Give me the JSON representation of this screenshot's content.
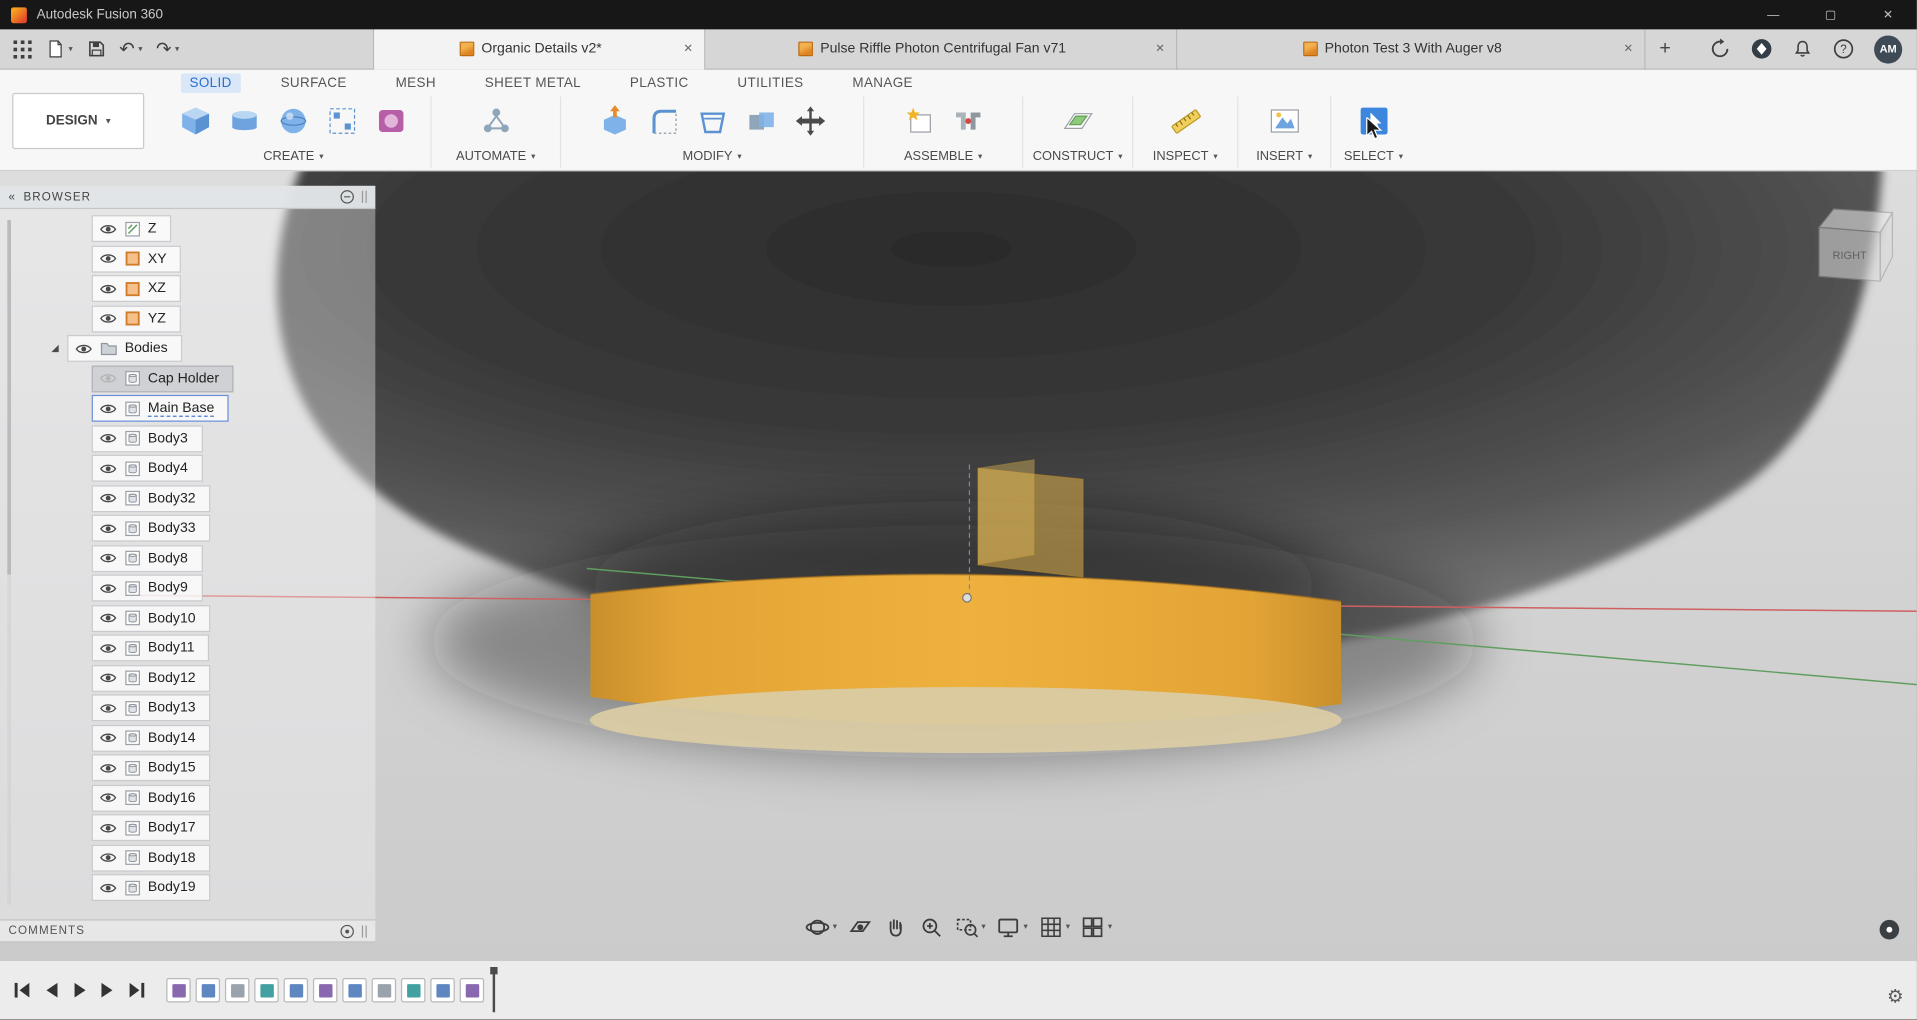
{
  "titlebar": {
    "title": "Autodesk Fusion 360"
  },
  "window_controls": {
    "minimize": "—",
    "maximize": "▢",
    "close": "✕"
  },
  "ui_glyphs": {
    "caret": "▾",
    "chevrons": "«",
    "plus": "+",
    "question": "?",
    "undo": "↶",
    "redo": "↷",
    "gear": "⚙",
    "close": "✕"
  },
  "quick_access": {
    "icons": [
      "app-grid",
      "file",
      "save",
      "undo",
      "redo"
    ]
  },
  "document_tabs": {
    "tabs": [
      {
        "label": "Organic Details v2*",
        "active": true
      },
      {
        "label": "Pulse Riffle Photon Centrifugal Fan v71",
        "active": false
      },
      {
        "label": "Photon Test 3 With Auger v8",
        "active": false
      }
    ],
    "header_icons": [
      "job-status",
      "extensions",
      "notifications",
      "help"
    ],
    "avatar_initials": "AM"
  },
  "ribbon": {
    "workspace": "DESIGN",
    "tabs": [
      {
        "label": "SOLID",
        "active": true
      },
      {
        "label": "SURFACE",
        "active": false
      },
      {
        "label": "MESH",
        "active": false
      },
      {
        "label": "SHEET METAL",
        "active": false
      },
      {
        "label": "PLASTIC",
        "active": false
      },
      {
        "label": "UTILITIES",
        "active": false
      },
      {
        "label": "MANAGE",
        "active": false
      }
    ],
    "groups": [
      {
        "label": "CREATE",
        "icons": [
          "box-primitive",
          "cylinder-primitive",
          "sphere-primitive",
          "pattern",
          "create-form"
        ]
      },
      {
        "label": "AUTOMATE",
        "icons": [
          "automate"
        ]
      },
      {
        "label": "MODIFY",
        "icons": [
          "press-pull",
          "fillet",
          "shell",
          "combine",
          "move-copy"
        ]
      },
      {
        "label": "ASSEMBLE",
        "icons": [
          "new-component",
          "joint"
        ]
      },
      {
        "label": "CONSTRUCT",
        "icons": [
          "construct-plane"
        ]
      },
      {
        "label": "INSPECT",
        "icons": [
          "measure"
        ]
      },
      {
        "label": "INSERT",
        "icons": [
          "canvas"
        ]
      },
      {
        "label": "SELECT",
        "icons": [
          "select-cursor"
        ]
      }
    ]
  },
  "browser": {
    "title": "BROWSER",
    "items": [
      {
        "label": "Z",
        "icon": "sketch",
        "indent": 1,
        "visible": true
      },
      {
        "label": "XY",
        "icon": "plane",
        "indent": 1,
        "visible": true
      },
      {
        "label": "XZ",
        "icon": "plane",
        "indent": 1,
        "visible": true
      },
      {
        "label": "YZ",
        "icon": "plane",
        "indent": 1,
        "visible": true
      },
      {
        "label": "Bodies",
        "icon": "folder",
        "indent": 0,
        "visible": true,
        "expanded": true
      },
      {
        "label": "Cap Holder",
        "icon": "body",
        "indent": 1,
        "visible": false,
        "hovered": true
      },
      {
        "label": "Main Base",
        "icon": "body",
        "indent": 1,
        "visible": true,
        "selected": true
      },
      {
        "label": "Body3",
        "icon": "body",
        "indent": 1,
        "visible": true
      },
      {
        "label": "Body4",
        "icon": "body",
        "indent": 1,
        "visible": true
      },
      {
        "label": "Body32",
        "icon": "body",
        "indent": 1,
        "visible": true
      },
      {
        "label": "Body33",
        "icon": "body",
        "indent": 1,
        "visible": true
      },
      {
        "label": "Body8",
        "icon": "body",
        "indent": 1,
        "visible": true
      },
      {
        "label": "Body9",
        "icon": "body",
        "indent": 1,
        "visible": true
      },
      {
        "label": "Body10",
        "icon": "body",
        "indent": 1,
        "visible": true
      },
      {
        "label": "Body11",
        "icon": "body",
        "indent": 1,
        "visible": true
      },
      {
        "label": "Body12",
        "icon": "body",
        "indent": 1,
        "visible": true
      },
      {
        "label": "Body13",
        "icon": "body",
        "indent": 1,
        "visible": true
      },
      {
        "label": "Body14",
        "icon": "body",
        "indent": 1,
        "visible": true
      },
      {
        "label": "Body15",
        "icon": "body",
        "indent": 1,
        "visible": true
      },
      {
        "label": "Body16",
        "icon": "body",
        "indent": 1,
        "visible": true
      },
      {
        "label": "Body17",
        "icon": "body",
        "indent": 1,
        "visible": true
      },
      {
        "label": "Body18",
        "icon": "body",
        "indent": 1,
        "visible": true
      },
      {
        "label": "Body19",
        "icon": "body",
        "indent": 1,
        "visible": true
      }
    ]
  },
  "comments": {
    "title": "COMMENTS"
  },
  "viewport": {
    "viewcube_face": "RIGHT",
    "nav_icons": [
      "orbit",
      "look-at",
      "pan",
      "zoom",
      "window-zoom",
      "display-settings",
      "grid",
      "viewports"
    ],
    "colors": {
      "body_yellow": "#ecae3a",
      "body_bottom": "#d9cba3",
      "dark_part": "#383838"
    }
  },
  "timeline": {
    "playback_icons": [
      "skip-start",
      "step-back",
      "play",
      "step-forward",
      "skip-end"
    ],
    "features": [
      {
        "color": "#8a68b0"
      },
      {
        "color": "#5e86c0"
      },
      {
        "color": "#9aa2ac"
      },
      {
        "color": "#43a0a0"
      },
      {
        "color": "#5e86c0"
      },
      {
        "color": "#8a68b0"
      },
      {
        "color": "#5e86c0"
      },
      {
        "color": "#9aa2ac"
      },
      {
        "color": "#43a0a0"
      },
      {
        "color": "#5e86c0"
      },
      {
        "color": "#8a68b0"
      }
    ]
  }
}
